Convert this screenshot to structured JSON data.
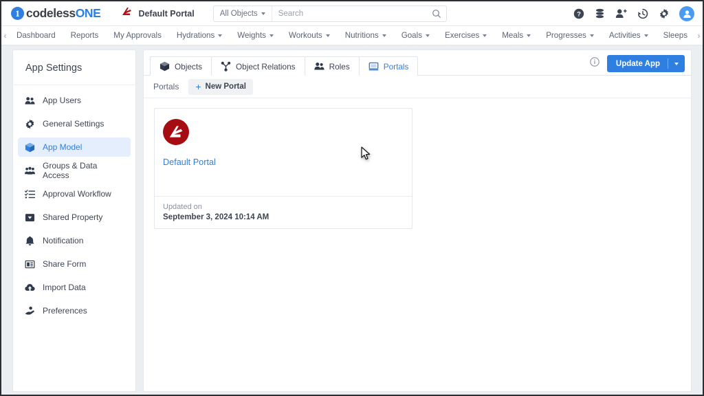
{
  "brand": {
    "mark_icon": "circle-one-icon",
    "name_dark": "codeless",
    "name_blue": "ONE"
  },
  "topbar": {
    "app_context_icon": "appian-logo-icon",
    "app_context_label": "Default Portal",
    "search": {
      "scope_label": "All Objects",
      "scope_caret_icon": "chevron-down-icon",
      "placeholder": "Search",
      "value": "",
      "search_icon": "search-icon"
    },
    "icons": [
      {
        "name": "help-icon",
        "glyph": "?"
      },
      {
        "name": "database-icon",
        "glyph": ""
      },
      {
        "name": "add-user-icon",
        "glyph": ""
      },
      {
        "name": "history-icon",
        "glyph": ""
      },
      {
        "name": "gear-icon",
        "glyph": ""
      }
    ],
    "avatar_icon": "user-avatar-icon"
  },
  "navbar": {
    "scroll_left_icon": "chevron-left-icon",
    "scroll_right_icon": "chevron-right-icon",
    "items": [
      {
        "label": "Dashboard",
        "has_caret": false
      },
      {
        "label": "Reports",
        "has_caret": false
      },
      {
        "label": "My Approvals",
        "has_caret": false
      },
      {
        "label": "Hydrations",
        "has_caret": true
      },
      {
        "label": "Weights",
        "has_caret": true
      },
      {
        "label": "Workouts",
        "has_caret": true
      },
      {
        "label": "Nutritions",
        "has_caret": true
      },
      {
        "label": "Goals",
        "has_caret": true
      },
      {
        "label": "Exercises",
        "has_caret": true
      },
      {
        "label": "Meals",
        "has_caret": true
      },
      {
        "label": "Progresses",
        "has_caret": true
      },
      {
        "label": "Activities",
        "has_caret": true
      },
      {
        "label": "Sleeps",
        "has_caret": false
      }
    ]
  },
  "sidebar": {
    "title": "App Settings",
    "items": [
      {
        "label": "App Users",
        "icon": "users-icon",
        "active": false
      },
      {
        "label": "General Settings",
        "icon": "gear-icon",
        "active": false
      },
      {
        "label": "App Model",
        "icon": "cube-icon",
        "active": true
      },
      {
        "label": "Groups & Data Access",
        "icon": "group-access-icon",
        "active": false
      },
      {
        "label": "Approval Workflow",
        "icon": "checklist-icon",
        "active": false
      },
      {
        "label": "Shared Property",
        "icon": "shared-property-icon",
        "active": false
      },
      {
        "label": "Notification",
        "icon": "bell-icon",
        "active": false
      },
      {
        "label": "Share Form",
        "icon": "share-form-icon",
        "active": false
      },
      {
        "label": "Import Data",
        "icon": "cloud-upload-icon",
        "active": false
      },
      {
        "label": "Preferences",
        "icon": "preferences-icon",
        "active": false
      }
    ]
  },
  "main": {
    "tabs": [
      {
        "label": "Objects",
        "icon": "cube-icon",
        "active": false
      },
      {
        "label": "Object Relations",
        "icon": "relations-icon",
        "active": false
      },
      {
        "label": "Roles",
        "icon": "roles-icon",
        "active": false
      },
      {
        "label": "Portals",
        "icon": "monitor-icon",
        "active": true
      }
    ],
    "info_icon": "info-icon",
    "update_button": {
      "label": "Update App",
      "caret_icon": "chevron-down-icon"
    },
    "subbar": {
      "label": "Portals",
      "new_button_label": "New Portal",
      "new_button_icon": "plus-icon"
    },
    "portal_cards": [
      {
        "logo_icon": "appian-portal-logo-icon",
        "name": "Default Portal",
        "updated_label": "Updated on",
        "updated_value": "September 3, 2024 10:14 AM"
      }
    ]
  },
  "colors": {
    "accent_blue": "#2f7fe0",
    "active_sidebar_bg": "#e4eefc",
    "portal_logo_red": "#a60d12",
    "text_dark": "#3c4552",
    "text_muted": "#6b7280",
    "page_bg": "#eceff1"
  },
  "cursor": {
    "icon": "mouse-pointer-icon"
  }
}
